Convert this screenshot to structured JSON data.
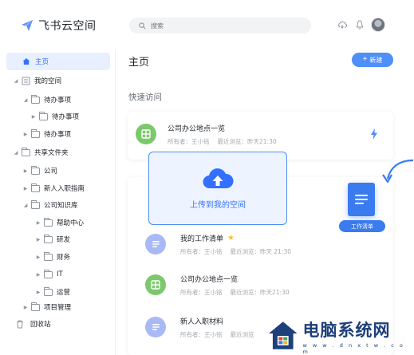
{
  "app": {
    "name": "飞书云空间"
  },
  "search": {
    "placeholder": "搜索"
  },
  "sidebar": {
    "home": "主页",
    "my_space": "我的空间",
    "my_space_items": [
      "待办事项",
      "待办事项",
      "待办事项"
    ],
    "shared_folder": "共享文件夹",
    "shared_items": [
      "公司",
      "新人入职指南",
      "公司知识库"
    ],
    "kb_items": [
      "帮助中心",
      "研发",
      "财务",
      "IT",
      "运营"
    ],
    "project_mgmt": "项目管理",
    "trash": "回收站"
  },
  "main": {
    "title": "主页",
    "new_button": "新建",
    "quick_access": "快速访问",
    "upload_label": "上传到我的空间",
    "drag_label": "工作清单",
    "files": [
      {
        "name": "公司办公地点一览",
        "owner": "所有者：王小铭",
        "recent": "最近浏览：昨天21:30"
      },
      {
        "name": "我的工作清单",
        "owner": "所有者：王小铭",
        "recent": "最近浏览：昨天 21:30"
      },
      {
        "name": "公司办公地点一览",
        "owner": "所有者：王小铭",
        "recent": "最近浏览：昨天21:30"
      },
      {
        "name": "新人入职材料",
        "owner": "所有者：王小铭",
        "recent": "最近浏览"
      }
    ]
  },
  "watermark": {
    "title": "电脑系统网",
    "url": "w w w . d n x t w . c o m"
  },
  "colors": {
    "accent": "#3370ff",
    "button": "#4e8ff8",
    "green": "#7bc96b",
    "purple": "#a9b9f5",
    "star": "#f5c12e"
  }
}
